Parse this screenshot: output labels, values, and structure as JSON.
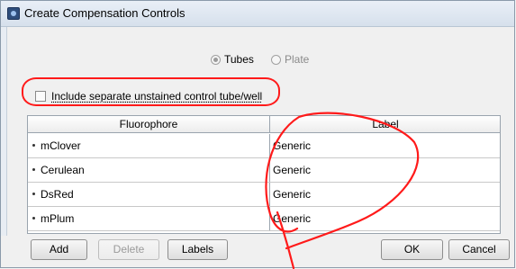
{
  "window": {
    "title": "Create Compensation Controls"
  },
  "mode": {
    "options": [
      {
        "label": "Tubes",
        "selected": true
      },
      {
        "label": "Plate",
        "selected": false
      }
    ]
  },
  "unstained": {
    "label": "Include separate unstained control tube/well",
    "checked": false
  },
  "table": {
    "headers": [
      "Fluorophore",
      "Label"
    ],
    "rows": [
      {
        "fluorophore": "mClover",
        "label": "Generic"
      },
      {
        "fluorophore": "Cerulean",
        "label": "Generic"
      },
      {
        "fluorophore": "DsRed",
        "label": "Generic"
      },
      {
        "fluorophore": "mPlum",
        "label": "Generic"
      }
    ]
  },
  "buttons": {
    "add": "Add",
    "delete": "Delete",
    "labels": "Labels",
    "ok": "OK",
    "cancel": "Cancel"
  },
  "annotation_color": "#ff1a1a"
}
